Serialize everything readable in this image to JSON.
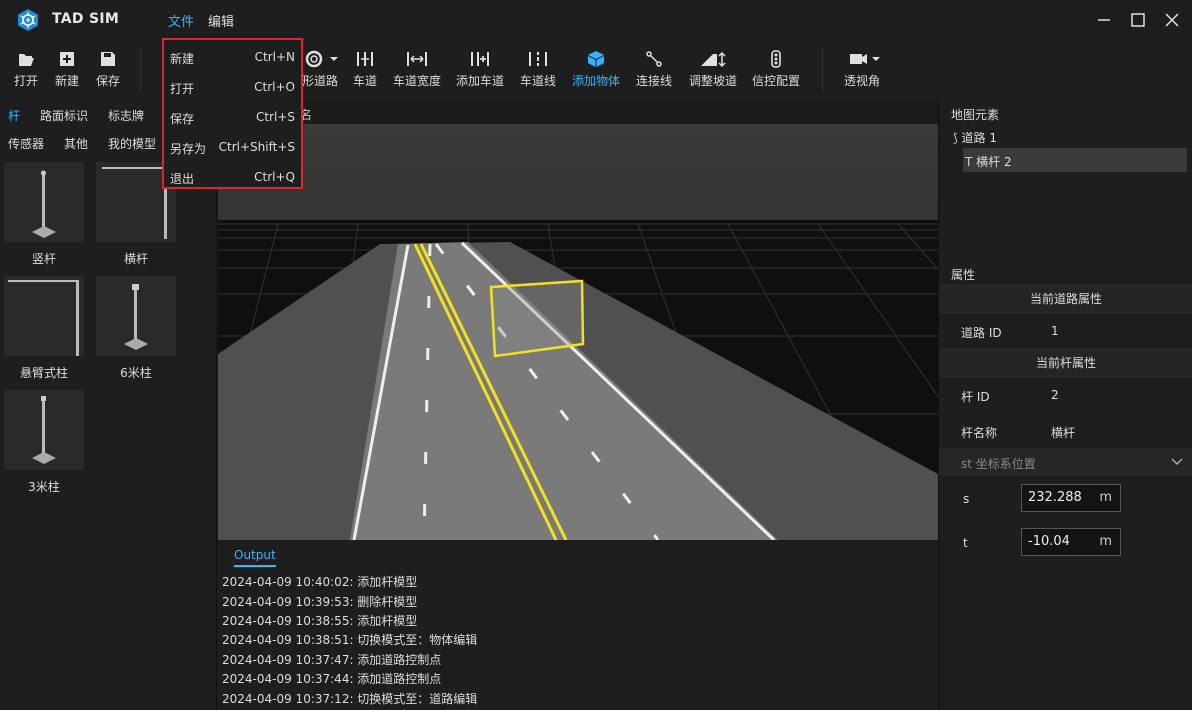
{
  "app": {
    "title": "TAD SIM"
  },
  "menu": {
    "file": "文件",
    "edit": "编辑"
  },
  "file_menu": [
    {
      "label": "新建",
      "shortcut": "Ctrl+N"
    },
    {
      "label": "打开",
      "shortcut": "Ctrl+O"
    },
    {
      "label": "保存",
      "shortcut": "Ctrl+S"
    },
    {
      "label": "另存为",
      "shortcut": "Ctrl+Shift+S"
    },
    {
      "label": "退出",
      "shortcut": "Ctrl+Q"
    }
  ],
  "toolbar": {
    "open": "打开",
    "new": "新建",
    "save": "保存",
    "ring_road": "形道路",
    "lane": "车道",
    "lane_width": "车道宽度",
    "add_lane": "添加车道",
    "lane_line": "车道线",
    "add_object": "添加物体",
    "connect_line": "连接线",
    "adjust_slope": "调整坡道",
    "signal_config": "信控配置",
    "perspective": "透视角"
  },
  "left_panel": {
    "tabs_row1": [
      "杆",
      "路面标识",
      "标志牌"
    ],
    "tabs_row2": [
      "传感器",
      "其他",
      "我的模型"
    ],
    "models": [
      "竖杆",
      "横杆",
      "悬臂式柱",
      "6米柱",
      "3米柱"
    ]
  },
  "viewport": {
    "title_fragment": "名"
  },
  "output": {
    "tab": "Output",
    "lines": [
      "2024-04-09 10:40:02: 添加杆模型",
      "2024-04-09 10:39:53: 删除杆模型",
      "2024-04-09 10:38:55: 添加杆模型",
      "2024-04-09 10:38:51: 切换模式至：物体编辑",
      "2024-04-09 10:37:47: 添加道路控制点",
      "2024-04-09 10:37:44: 添加道路控制点",
      "2024-04-09 10:37:12: 切换模式至：道路编辑"
    ]
  },
  "right_panel": {
    "map_elements_title": "地图元素",
    "tree": [
      "道路 1",
      "横杆 2"
    ],
    "properties_title": "属性",
    "road_props_title": "当前道路属性",
    "road_id_label": "道路 ID",
    "road_id": "1",
    "pole_props_title": "当前杆属性",
    "pole_id_label": "杆 ID",
    "pole_id": "2",
    "pole_name_label": "杆名称",
    "pole_name": "横杆",
    "st_section": "st 坐标系位置",
    "s_label": "s",
    "s_value": "232.288",
    "t_label": "t",
    "t_value": "-10.04",
    "unit": "m"
  },
  "colors": {
    "accent": "#2fb6ff",
    "highlight_border": "#e0262c",
    "lane_yellow": "#f2e21a"
  }
}
